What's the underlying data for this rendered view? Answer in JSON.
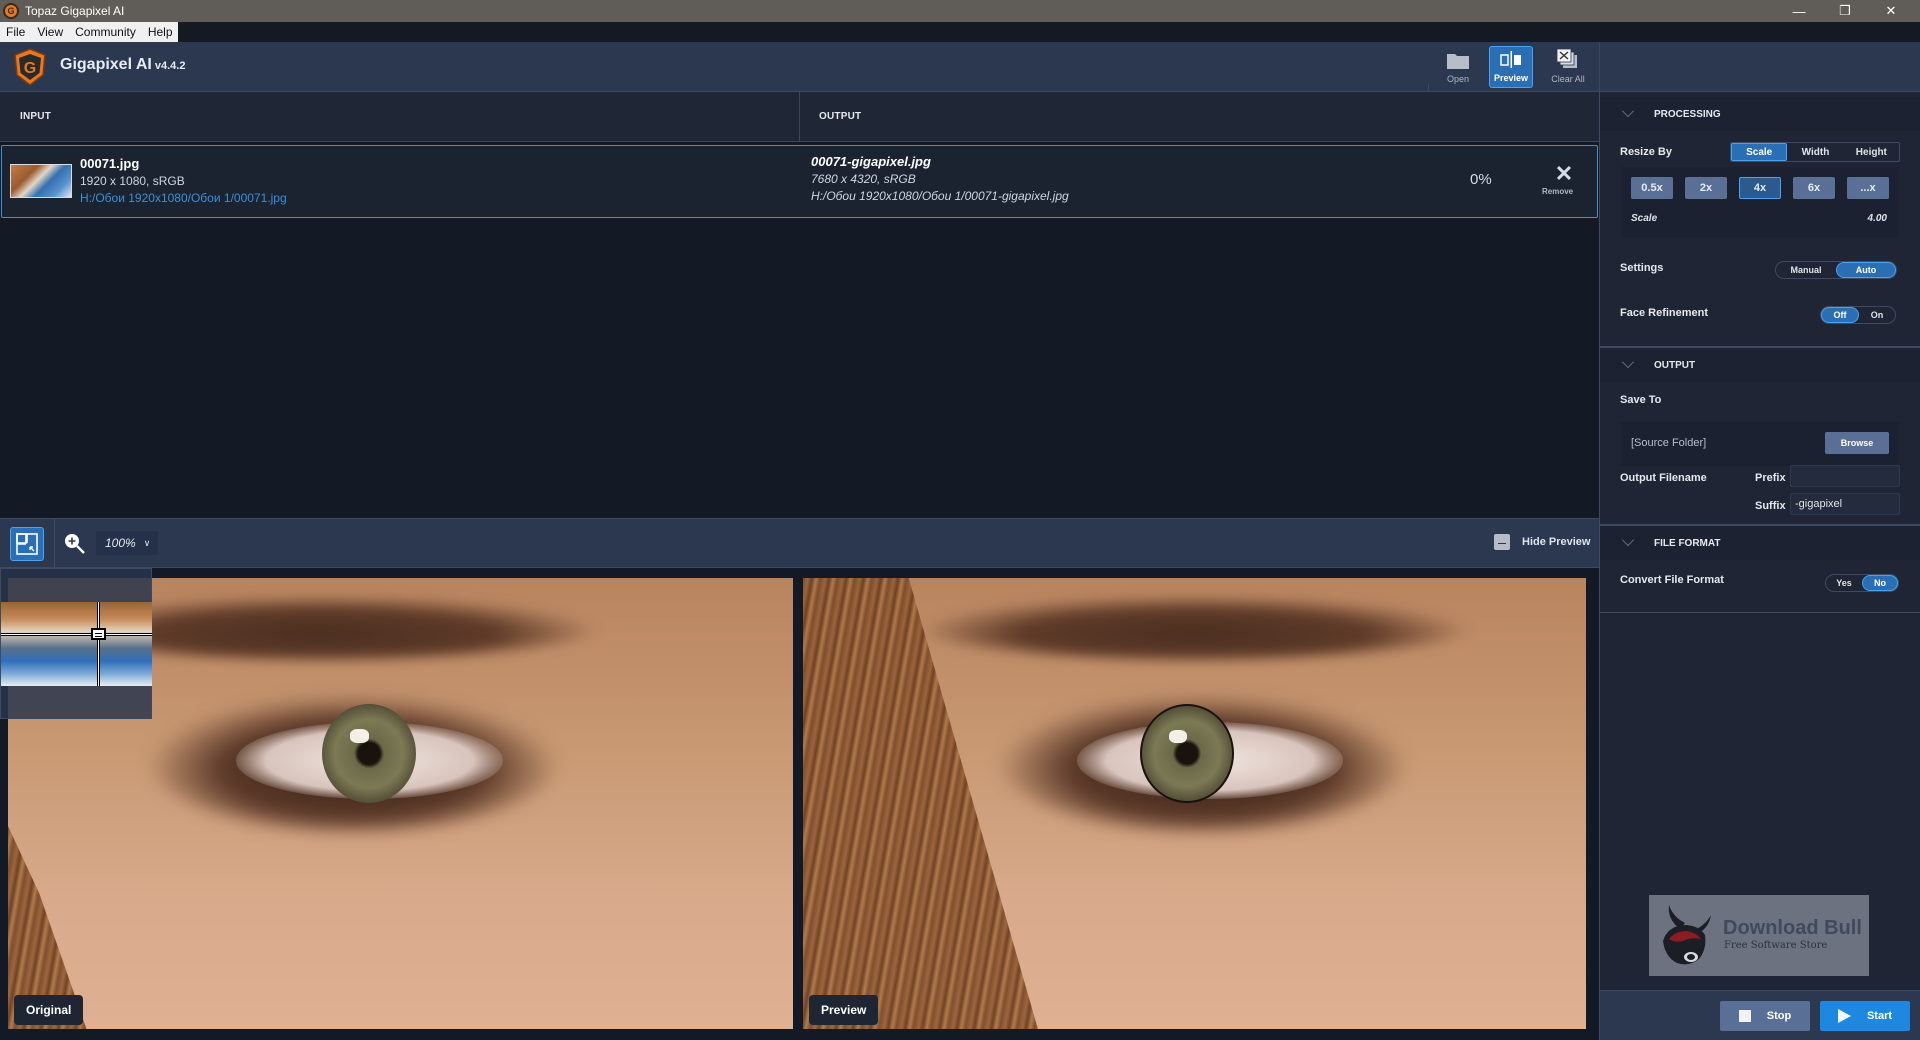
{
  "window": {
    "title": "Topaz Gigapixel AI",
    "controls": {
      "minimize": "—",
      "maximize": "❐",
      "close": "✕"
    }
  },
  "menu": [
    "File",
    "View",
    "Community",
    "Help"
  ],
  "header": {
    "app_name": "Gigapixel AI",
    "version": "v4.4.2",
    "buttons": [
      {
        "label": "Open",
        "icon": "folder-icon",
        "active": false
      },
      {
        "label": "Preview",
        "icon": "split-preview-icon",
        "active": true
      },
      {
        "label": "Clear All",
        "icon": "clear-all-icon",
        "active": false
      }
    ]
  },
  "file_list": {
    "columns": {
      "input": "INPUT",
      "output": "OUTPUT"
    },
    "rows": [
      {
        "input": {
          "name": "00071.jpg",
          "meta": "1920 x 1080, sRGB",
          "path": "H:/Обои 1920x1080/Обои 1/00071.jpg"
        },
        "output": {
          "name": "00071-gigapixel.jpg",
          "meta": "7680 x 4320, sRGB",
          "path": "H:/Обои 1920x1080/Обои 1/00071-gigapixel.jpg"
        },
        "progress": "0%",
        "remove_label": "Remove"
      }
    ]
  },
  "preview_toolbar": {
    "zoom_level": "100%",
    "hide_preview_label": "Hide Preview"
  },
  "preview": {
    "original_label": "Original",
    "preview_label": "Preview"
  },
  "processing": {
    "section_title": "PROCESSING",
    "resize_by_label": "Resize By",
    "resize_by_options": [
      "Scale",
      "Width",
      "Height"
    ],
    "resize_by_selected": "Scale",
    "scale_buttons": [
      "0.5x",
      "2x",
      "4x",
      "6x",
      "...x"
    ],
    "scale_selected": "4x",
    "scale_label": "Scale",
    "scale_value": "4.00",
    "settings_label": "Settings",
    "settings_options": [
      "Manual",
      "Auto"
    ],
    "settings_selected": "Auto",
    "face_refinement_label": "Face Refinement",
    "face_refinement_options": [
      "Off",
      "On"
    ],
    "face_refinement_selected": "Off"
  },
  "output": {
    "section_title": "OUTPUT",
    "save_to_label": "Save To",
    "save_to_value": "[Source Folder]",
    "browse_label": "Browse",
    "output_filename_label": "Output Filename",
    "prefix_label": "Prefix",
    "prefix_value": "",
    "suffix_label": "Suffix",
    "suffix_value": "-gigapixel"
  },
  "file_format": {
    "section_title": "FILE FORMAT",
    "convert_label": "Convert File Format",
    "convert_options": [
      "Yes",
      "No"
    ],
    "convert_selected": "No"
  },
  "watermark": {
    "title": "Download Bull",
    "subtitle": "Free Software Store"
  },
  "actions": {
    "stop_label": "Stop",
    "start_label": "Start"
  },
  "colors": {
    "accent": "#2a6fb4",
    "accent_border": "#4aa2f0",
    "start_button": "#1e88e0",
    "secondary_button": "#5a6f96",
    "brand_orange": "#e8771f"
  }
}
